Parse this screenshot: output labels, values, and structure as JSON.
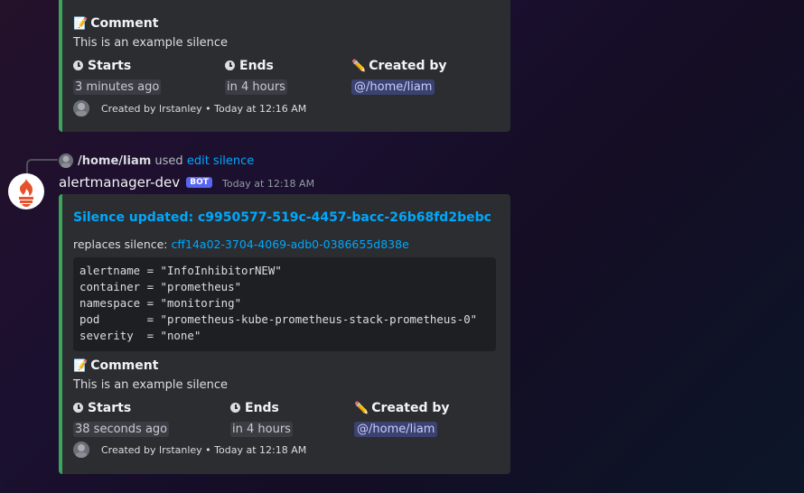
{
  "embed_top": {
    "comment_heading": "Comment",
    "comment_text": "This is an example silence",
    "starts_label": "Starts",
    "starts_value": "3 minutes ago",
    "ends_label": "Ends",
    "ends_value": "in 4 hours",
    "created_label": "Created by",
    "created_value": "@/home/liam",
    "footer": "Created by lrstanley • Today at 12:16 AM"
  },
  "command_reply": {
    "user": "/home/liam",
    "used": "used",
    "command": "edit silence"
  },
  "message": {
    "author": "alertmanager-dev",
    "bot_badge": "BOT",
    "timestamp": "Today at 12:18 AM"
  },
  "embed_main": {
    "title": "Silence updated: c9950577-519c-4457-bacc-26b68fd2bebc",
    "replaces_label": "replaces silence:",
    "replaces_value": "cff14a02-3704-4069-adb0-0386655d838e",
    "code_lines": [
      "alertname = \"InfoInhibitorNEW\"",
      "container = \"prometheus\"",
      "namespace = \"monitoring\"",
      "pod       = \"prometheus-kube-prometheus-stack-prometheus-0\"",
      "severity  = \"none\""
    ],
    "comment_heading": "Comment",
    "comment_text": "This is an example silence",
    "starts_label": "Starts",
    "starts_value": "38 seconds ago",
    "ends_label": "Ends",
    "ends_value": "in 4 hours",
    "created_label": "Created by",
    "created_value": "@/home/liam",
    "footer": "Created by lrstanley • Today at 12:18 AM"
  },
  "colors": {
    "embed_accent": "#3ba55c",
    "link": "#00a8fc",
    "bot_badge": "#5865f2"
  },
  "icons": [
    "memo-icon",
    "clock-icon",
    "pencil-icon",
    "prometheus-logo",
    "user-avatar"
  ]
}
